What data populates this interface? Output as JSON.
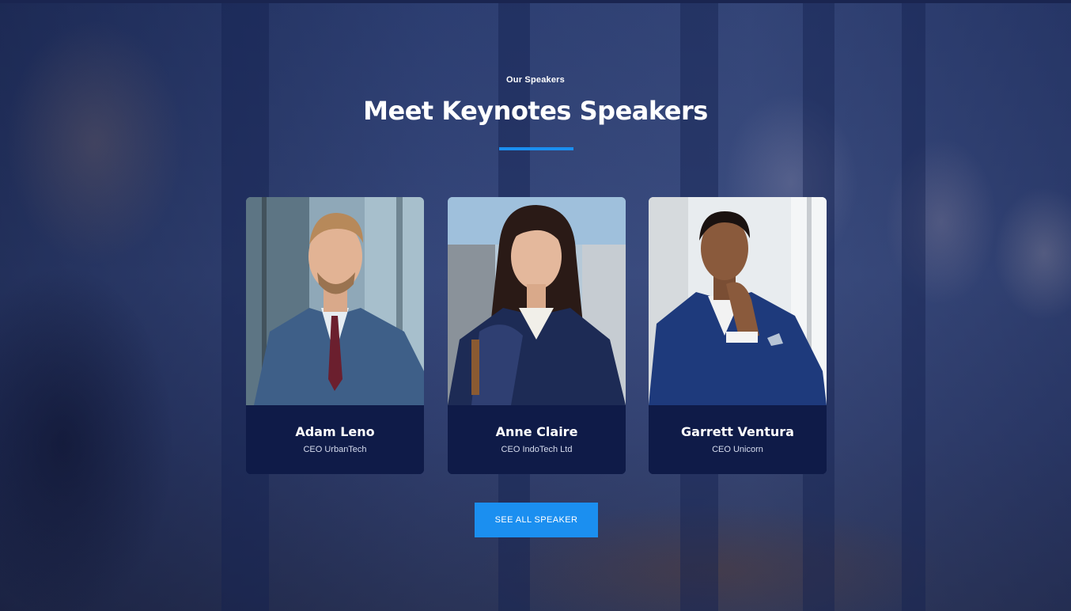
{
  "section": {
    "eyebrow": "Our Speakers",
    "title": "Meet Keynotes Speakers"
  },
  "speakers": [
    {
      "name": "Adam Leno",
      "role": "CEO UrbanTech"
    },
    {
      "name": "Anne Claire",
      "role": "CEO IndoTech Ltd"
    },
    {
      "name": "Garrett Ventura",
      "role": "CEO Unicorn"
    }
  ],
  "cta": {
    "label": "SEE ALL SPEAKER"
  },
  "colors": {
    "accent": "#1b8ff0",
    "card_bg": "#0f1b48",
    "overlay": "#2e3f72"
  }
}
